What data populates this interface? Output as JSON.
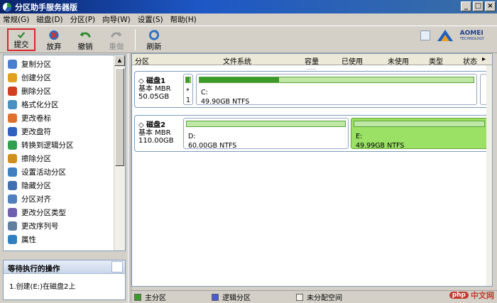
{
  "window": {
    "title": "分区助手服务器版",
    "controls": [
      "_",
      "□",
      "×"
    ]
  },
  "menu": [
    "常规(G)",
    "磁盘(D)",
    "分区(P)",
    "向导(W)",
    "设置(S)",
    "帮助(H)"
  ],
  "toolbar": {
    "submit": "提交",
    "discard": "放弃",
    "undo": "撤销",
    "redo": "重做",
    "refresh": "刷新"
  },
  "brand": {
    "name": "AOMEI",
    "sub": "TECHNOLOGY"
  },
  "operations": [
    {
      "label": "复制分区",
      "icon": "copy-partition-icon",
      "color": "#4a7fd0"
    },
    {
      "label": "创建分区",
      "icon": "create-partition-icon",
      "color": "#e0a020"
    },
    {
      "label": "删除分区",
      "icon": "delete-partition-icon",
      "color": "#d04020"
    },
    {
      "label": "格式化分区",
      "icon": "format-partition-icon",
      "color": "#4a90c0"
    },
    {
      "label": "更改卷标",
      "icon": "volume-label-icon",
      "color": "#e07030"
    },
    {
      "label": "更改盘符",
      "icon": "drive-letter-icon",
      "color": "#3060c0"
    },
    {
      "label": "转换到逻辑分区",
      "icon": "convert-logical-icon",
      "color": "#30a050"
    },
    {
      "label": "擦除分区",
      "icon": "wipe-partition-icon",
      "color": "#d09020"
    },
    {
      "label": "设置活动分区",
      "icon": "set-active-icon",
      "color": "#4080c0"
    },
    {
      "label": "隐藏分区",
      "icon": "hide-partition-icon",
      "color": "#4070b0"
    },
    {
      "label": "分区对齐",
      "icon": "align-partition-icon",
      "color": "#5080c0"
    },
    {
      "label": "更改分区类型",
      "icon": "partition-type-icon",
      "color": "#7060b0"
    },
    {
      "label": "更改序列号",
      "icon": "serial-number-icon",
      "color": "#6080a0"
    },
    {
      "label": "属性",
      "icon": "properties-icon",
      "color": "#3080c0"
    }
  ],
  "pending": {
    "title": "等待执行的操作",
    "items": [
      "1.创建(E:)在磁盘2上"
    ]
  },
  "columns": [
    "分区",
    "文件系统",
    "容量",
    "已使用",
    "未使用",
    "类型",
    "状态"
  ],
  "disks": [
    {
      "name": "磁盘1",
      "type": "基本 MBR",
      "size": "50.05GB",
      "partitions": [
        {
          "letter": "*",
          "info": "1",
          "used": 0.8
        },
        {
          "letter": "C:",
          "info": "49.90GB NTFS",
          "used": 0.29
        }
      ]
    },
    {
      "name": "磁盘2",
      "type": "基本 MBR",
      "size": "110.00GB",
      "partitions": [
        {
          "letter": "D:",
          "info": "60.00GB NTFS",
          "used": 0.0
        },
        {
          "letter": "E:",
          "info": "49.99GB NTFS",
          "used": 0.0
        }
      ]
    }
  ],
  "legend": [
    {
      "label": "主分区",
      "color": "#3a9a2a"
    },
    {
      "label": "逻辑分区",
      "color": "#4a5bd0"
    },
    {
      "label": "未分配空间",
      "color": "#f4f0e8"
    }
  ],
  "watermark": {
    "logo": "php",
    "text": "中文网"
  }
}
